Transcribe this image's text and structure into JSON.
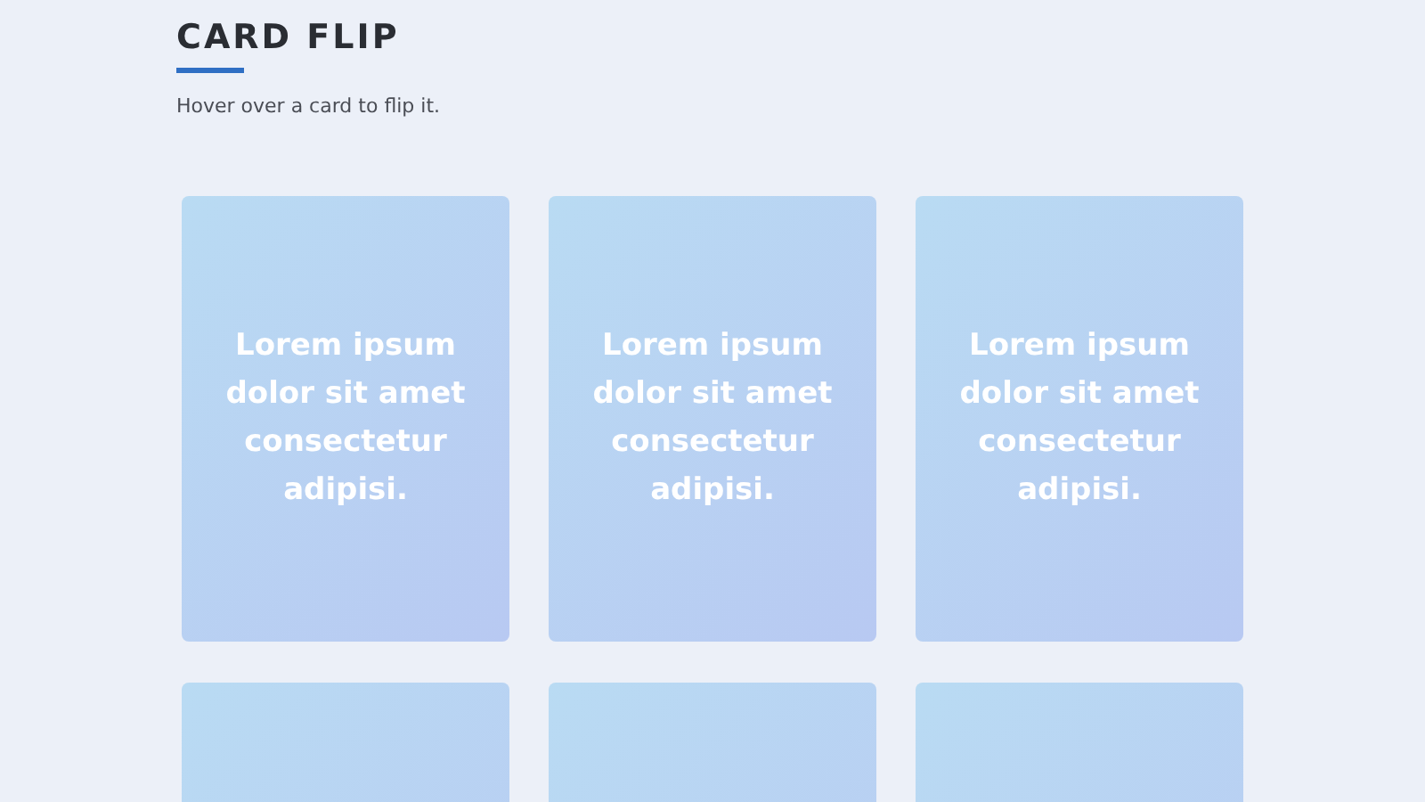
{
  "header": {
    "title": "CARD FLIP",
    "subtitle": "Hover over a card to flip it."
  },
  "cards": [
    {
      "kind": "text",
      "text": "Lorem ipsum dolor sit amet consectetur adipisi."
    },
    {
      "kind": "text",
      "text": "Lorem ipsum dolor sit amet consectetur adipisi."
    },
    {
      "kind": "text",
      "text": "Lorem ipsum dolor sit amet consectetur adipisi."
    },
    {
      "kind": "blank"
    },
    {
      "kind": "blank"
    },
    {
      "kind": "blank"
    }
  ]
}
